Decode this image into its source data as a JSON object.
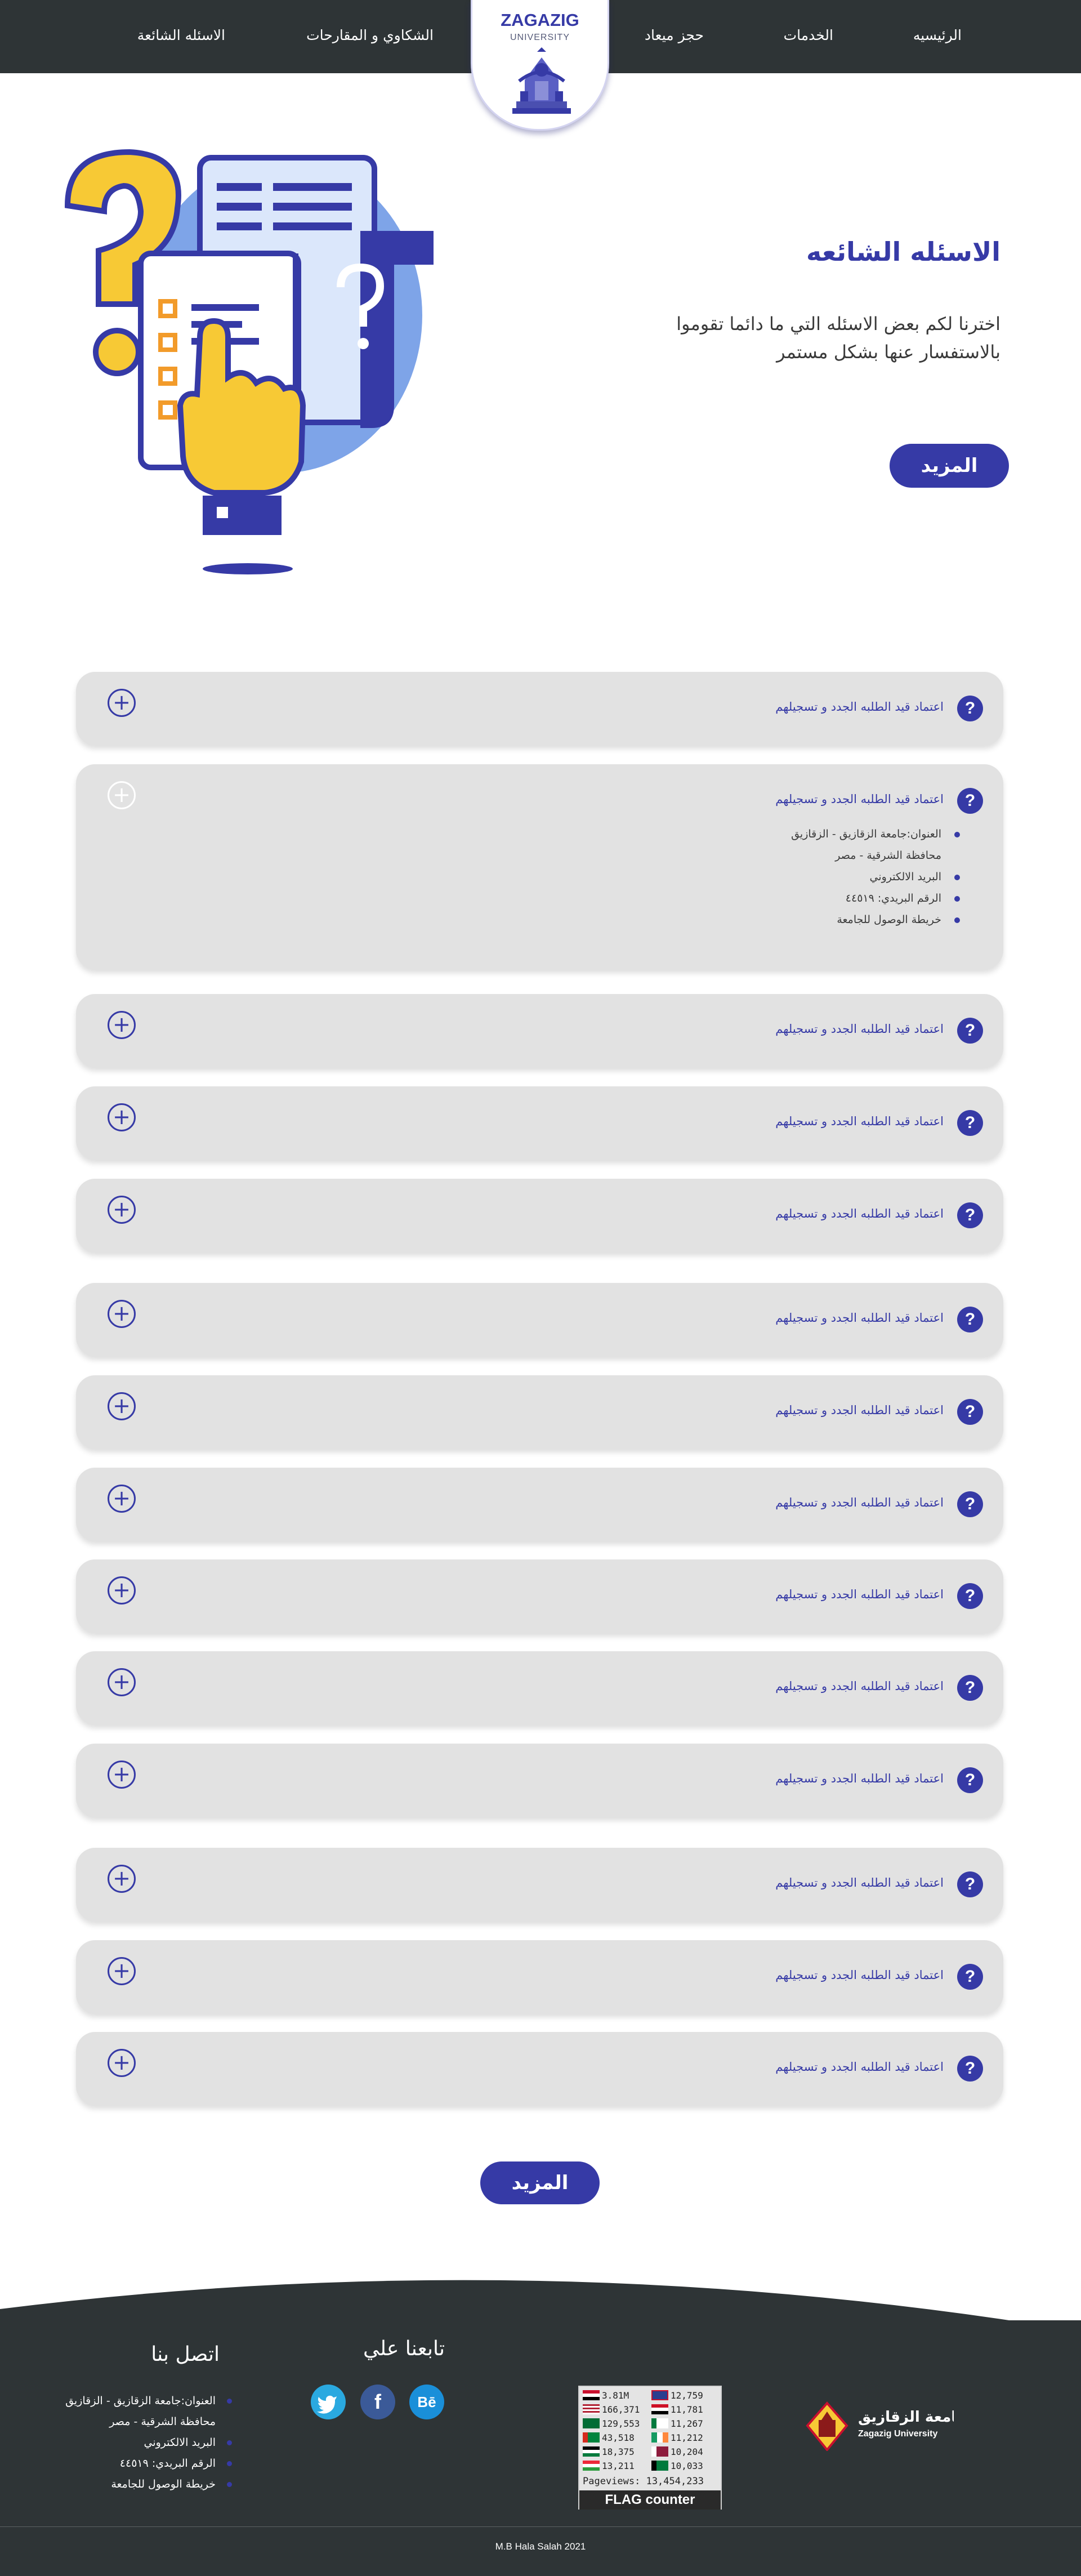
{
  "nav": {
    "home": "الرئيسيه",
    "services": "الخدمات",
    "booking": "حجز ميعاد",
    "complaints": "الشكاوي و المقارحات",
    "faq": "الاسئله الشائعة"
  },
  "logo": {
    "title": "ZAGAZIG",
    "subtitle": "UNIVERSITY"
  },
  "hero": {
    "title": "الاسئله الشائعه",
    "description": "اخترنا لكم بعض الاسئله التي ما دائما تقوموا بالاستفسار عنها بشكل مستمر",
    "more_label": "المزيد"
  },
  "faq": {
    "items": [
      {
        "question": "اعتماد قيد الطلبه الجدد و تسجيلهم",
        "open": false
      },
      {
        "question": "اعتماد قيد الطلبه الجدد و تسجيلهم",
        "open": true
      },
      {
        "question": "اعتماد قيد الطلبه الجدد و تسجيلهم",
        "open": false
      },
      {
        "question": "اعتماد قيد الطلبه الجدد و تسجيلهم",
        "open": false
      },
      {
        "question": "اعتماد قيد الطلبه الجدد و تسجيلهم",
        "open": false
      },
      {
        "question": "اعتماد قيد الطلبه الجدد و تسجيلهم",
        "open": false
      },
      {
        "question": "اعتماد قيد الطلبه الجدد و تسجيلهم",
        "open": false
      },
      {
        "question": "اعتماد قيد الطلبه الجدد و تسجيلهم",
        "open": false
      },
      {
        "question": "اعتماد قيد الطلبه الجدد و تسجيلهم",
        "open": false
      },
      {
        "question": "اعتماد قيد الطلبه الجدد و تسجيلهم",
        "open": false
      },
      {
        "question": "اعتماد قيد الطلبه الجدد و تسجيلهم",
        "open": false
      },
      {
        "question": "اعتماد قيد الطلبه الجدد و تسجيلهم",
        "open": false
      },
      {
        "question": "اعتماد قيد الطلبه الجدد و تسجيلهم",
        "open": false
      },
      {
        "question": "اعتماد قيد الطلبه الجدد و تسجيلهم",
        "open": false
      }
    ],
    "answer": {
      "address": "العنوان:جامعة الزقازيق - الزقازيق",
      "region": "محافظة الشرقية - مصر",
      "email": "البريد الالكتروني",
      "postal": "الرقم البريدي: ٤٤٥١٩",
      "map": "خريطة الوصول للجامعة"
    },
    "more_label": "المزيد"
  },
  "footer": {
    "contact_heading": "اتصل بنا",
    "follow_heading": "تابعنا علي",
    "contact": {
      "address": "العنوان:جامعة الزقازيق - الزقازيق",
      "region": "محافظة الشرقية - مصر",
      "email": "البريد الالكتروني",
      "postal": "الرقم البريدي: ٤٤٥١٩",
      "map": "خريطة الوصول للجامعة"
    },
    "social": {
      "twitter_color": "#2aa9e0",
      "facebook_color": "#3b5a98",
      "behance_color": "#1a8fd9",
      "behance_label": "Bē",
      "facebook_label": "f"
    },
    "counter": {
      "rows_left": [
        "3.81M",
        "166,371",
        "129,553",
        "43,518",
        "18,375",
        "13,211"
      ],
      "rows_right": [
        "12,759",
        "11,781",
        "11,267",
        "11,212",
        "10,204",
        "10,033"
      ],
      "pageviews": "Pageviews: 13,454,233",
      "brand": "FLAG counter"
    },
    "university_logo": {
      "arabic": "جامعة الزقازيق",
      "english": "Zagazig University"
    },
    "copyright": "M.B Hala Salah 2021"
  },
  "colors": {
    "primary": "#363aa6",
    "dark": "#2e3436",
    "card": "#e2e2e2"
  }
}
